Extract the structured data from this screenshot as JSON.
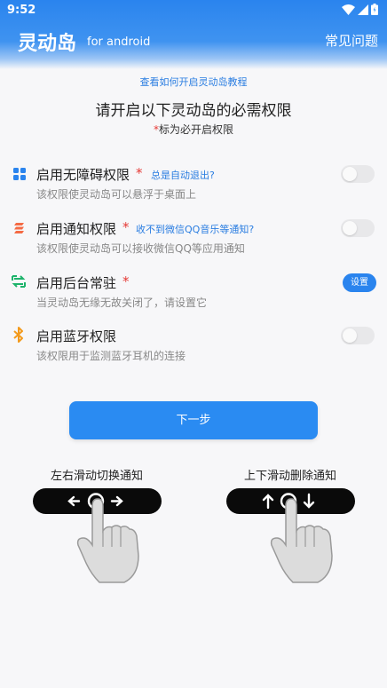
{
  "status_bar": {
    "time": "9:52"
  },
  "appbar": {
    "title": "灵动岛",
    "subtitle": "for android",
    "faq": "常见问题"
  },
  "intro": {
    "tutorial_link": "查看如何开启灵动岛教程",
    "headline": "请开启以下灵动岛的必需权限",
    "required_star": "*",
    "required_note": "标为必开启权限"
  },
  "permissions": [
    {
      "title": "启用无障碍权限",
      "star": "*",
      "help": "总是自动退出?",
      "desc": "该权限使灵动岛可以悬浮于桌面上",
      "control": "toggle"
    },
    {
      "title": "启用通知权限",
      "star": "*",
      "help": "收不到微信QQ音乐等通知?",
      "desc": "该权限使灵动岛可以接收微信QQ等应用通知",
      "control": "toggle"
    },
    {
      "title": "启用后台常驻",
      "star": "*",
      "help": "",
      "desc": "当灵动岛无缘无故关闭了，请设置它",
      "control": "button",
      "button_label": "设置"
    },
    {
      "title": "启用蓝牙权限",
      "star": "",
      "help": "",
      "desc": "该权限用于监测蓝牙耳机的连接",
      "control": "toggle"
    }
  ],
  "next_button": "下一步",
  "gestures": {
    "left": {
      "label": "左右滑动切换通知"
    },
    "right": {
      "label": "上下滑动删除通知"
    }
  },
  "colors": {
    "accent": "#2a84ee",
    "required": "#e53935",
    "link": "#2a7de1"
  }
}
